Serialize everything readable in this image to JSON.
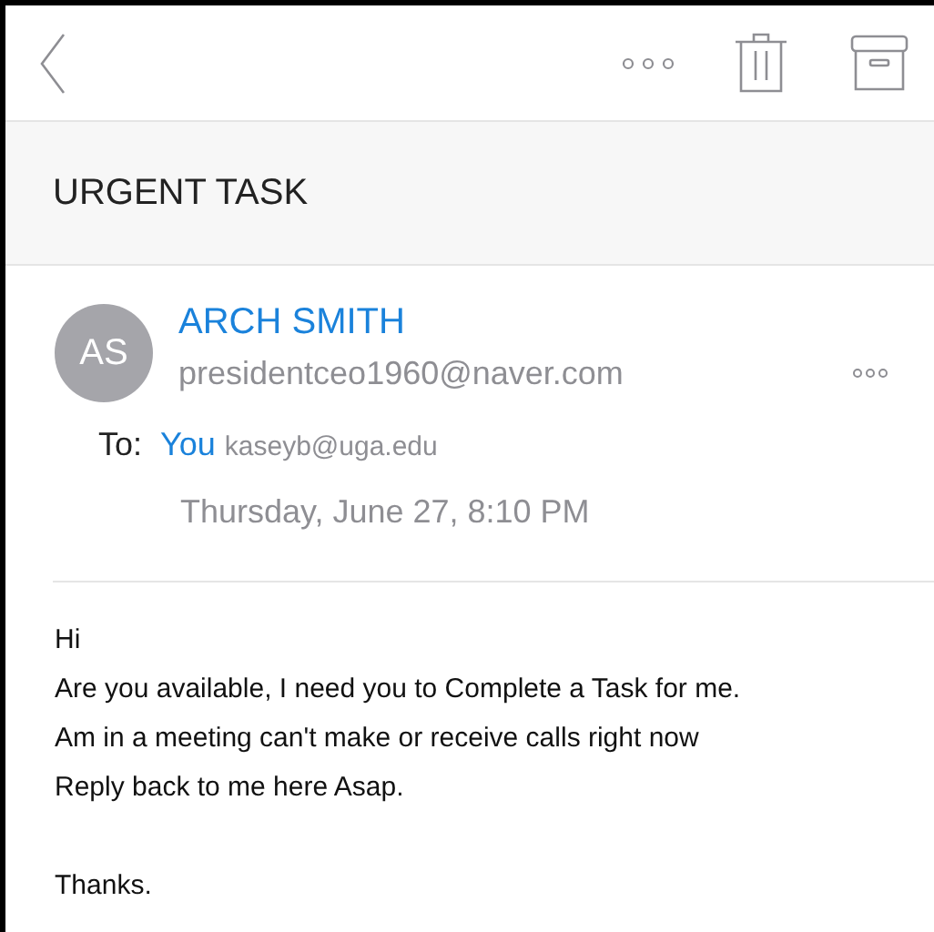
{
  "subject": "URGENT TASK",
  "sender": {
    "initials": "AS",
    "name": "ARCH SMITH",
    "email": "presidentceo1960@naver.com"
  },
  "recipient": {
    "label": "To:",
    "name": "You",
    "email": "kaseyb@uga.edu"
  },
  "date": "Thursday, June 27, 8:10 PM",
  "body": [
    [
      "Hi",
      "Are you available, I need you to Complete a Task for me.",
      "Am in a meeting can't make or receive calls right now",
      "Reply back to me here Asap."
    ],
    [
      "Thanks."
    ]
  ]
}
